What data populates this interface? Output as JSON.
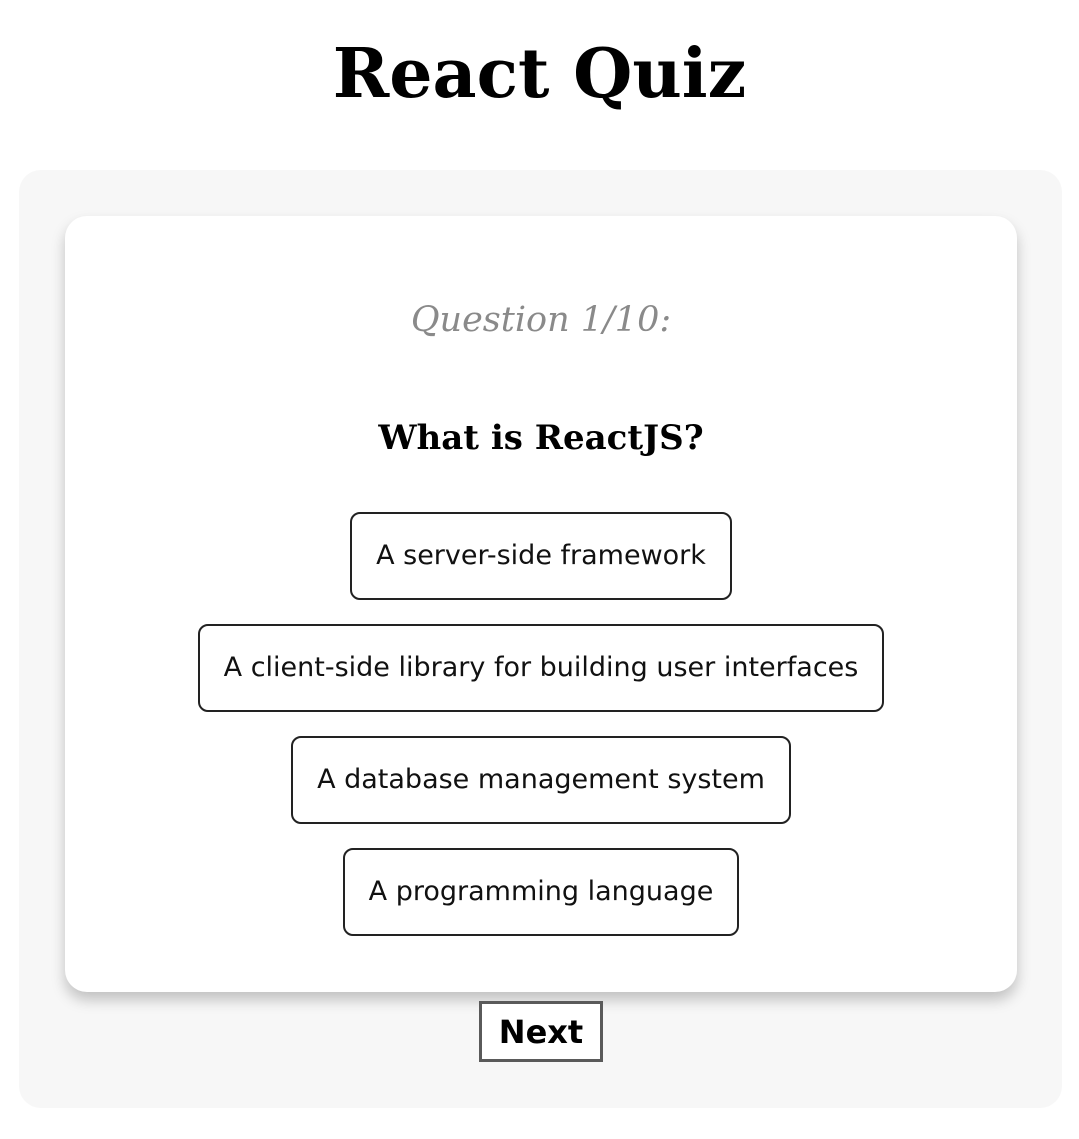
{
  "app": {
    "title": "React Quiz"
  },
  "quiz": {
    "question_counter": "Question 1/10:",
    "question": "What is ReactJS?",
    "answers": [
      "A server-side framework",
      "A client-side library for building user interfaces",
      "A database management system",
      "A programming language"
    ],
    "next_label": "Next"
  },
  "colors": {
    "panel_background": "#f7f7f7",
    "card_background": "#ffffff",
    "counter_text": "#8a8a8a",
    "option_border": "#222222",
    "next_border": "#5a5a5a"
  }
}
